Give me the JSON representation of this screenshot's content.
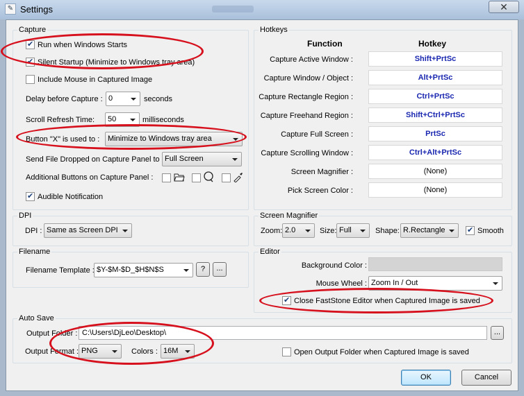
{
  "window": {
    "title": "Settings",
    "close_glyph": "✕"
  },
  "capture": {
    "legend": "Capture",
    "run_when_windows_starts": "Run when Windows Starts",
    "silent_startup": "Silent Startup (Minimize to Windows tray area)",
    "include_mouse": "Include Mouse in Captured Image",
    "delay_label": "Delay before Capture :",
    "delay_value": "0",
    "delay_unit": "seconds",
    "scroll_label": "Scroll Refresh Time:",
    "scroll_value": "50",
    "scroll_unit": "milliseconds",
    "button_x_label": "Button \"X\" is used to :",
    "button_x_value": "Minimize to Windows tray area",
    "send_file_label": "Send File Dropped on Capture Panel to :",
    "send_file_value": "Full Screen",
    "additional_buttons_label": "Additional Buttons on Capture Panel :",
    "audible_notification": "Audible Notification",
    "checked": {
      "run": true,
      "silent": true,
      "mouse": false,
      "audible": true,
      "btn1": false,
      "btn2": false,
      "btn3": false
    }
  },
  "hotkeys": {
    "legend": "Hotkeys",
    "function_header": "Function",
    "hotkey_header": "Hotkey",
    "rows": [
      {
        "function": "Capture Active Window :",
        "hotkey": "Shift+PrtSc"
      },
      {
        "function": "Capture Window / Object :",
        "hotkey": "Alt+PrtSc"
      },
      {
        "function": "Capture Rectangle Region :",
        "hotkey": "Ctrl+PrtSc"
      },
      {
        "function": "Capture Freehand Region :",
        "hotkey": "Shift+Ctrl+PrtSc"
      },
      {
        "function": "Capture Full Screen :",
        "hotkey": "PrtSc"
      },
      {
        "function": "Capture Scrolling Window :",
        "hotkey": "Ctrl+Alt+PrtSc"
      },
      {
        "function": "Screen Magnifier :",
        "hotkey": "(None)"
      },
      {
        "function": "Pick Screen Color :",
        "hotkey": "(None)"
      }
    ]
  },
  "dpi": {
    "legend": "DPI",
    "label": "DPI :",
    "value": "Same as Screen DPI"
  },
  "magnifier": {
    "legend": "Screen Magnifier",
    "zoom_label": "Zoom:",
    "zoom_value": "2.0",
    "size_label": "Size:",
    "size_value": "Full",
    "shape_label": "Shape:",
    "shape_value": "R.Rectangle",
    "smooth_label": "Smooth",
    "smooth_checked": true
  },
  "filename": {
    "legend": "Filename",
    "template_label": "Filename Template :",
    "template_value": "$Y-$M-$D_$H$N$S",
    "help_label": "?",
    "more_label": "..."
  },
  "editor": {
    "legend": "Editor",
    "background_label": "Background Color :",
    "background_color": "#d4d4d4",
    "mouse_wheel_label": "Mouse Wheel :",
    "mouse_wheel_value": "Zoom In / Out",
    "close_editor_label": "Close FastStone Editor when Captured Image is saved",
    "close_editor_checked": true
  },
  "autosave": {
    "legend": "Auto Save",
    "output_folder_label": "Output Folder :",
    "output_folder_value": "C:\\Users\\DjLeo\\Desktop\\",
    "browse_label": "...",
    "output_format_label": "Output Format :",
    "output_format_value": "PNG",
    "colors_label": "Colors :",
    "colors_value": "16M",
    "open_folder_label": "Open Output Folder when Captured Image is saved",
    "open_folder_checked": false
  },
  "buttons": {
    "ok": "OK",
    "cancel": "Cancel"
  },
  "annotation_color": "#d6101c"
}
